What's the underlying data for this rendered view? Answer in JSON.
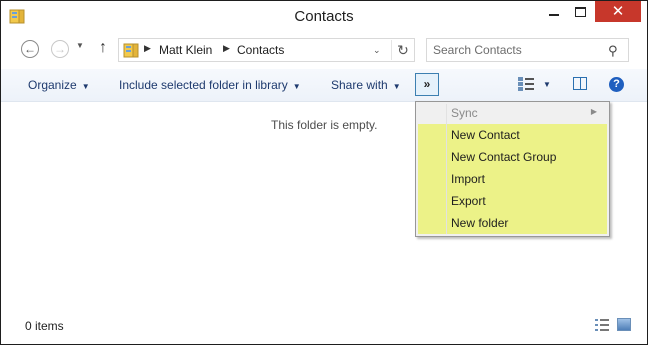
{
  "window": {
    "title": "Contacts",
    "close_glyph": "✕"
  },
  "nav": {
    "back_glyph": "←",
    "forward_glyph": "→",
    "recent_glyph": "▼",
    "up_glyph": "↑",
    "breadcrumb": [
      "Matt Klein",
      "Contacts"
    ],
    "separator_glyph": "▶",
    "dropdown_glyph": "⌄",
    "refresh_glyph": "↻",
    "search_placeholder": "Search Contacts",
    "search_glyph": "⚲"
  },
  "commandbar": {
    "organize": "Organize",
    "include_library": "Include selected folder in library",
    "share_with": "Share with",
    "more_glyph": "»",
    "arrow_glyph": "▼",
    "help_glyph": "?"
  },
  "content": {
    "empty_message": "This folder is empty."
  },
  "menu": {
    "items": [
      {
        "label": "Sync"
      },
      {
        "label": "New Contact"
      },
      {
        "label": "New Contact Group"
      },
      {
        "label": "Import"
      },
      {
        "label": "Export"
      },
      {
        "label": "New folder"
      }
    ],
    "submenu_glyph": "▶"
  },
  "status": {
    "item_count": "0 items"
  },
  "colors": {
    "close_red": "#c7372b",
    "menu_highlight": "#ecf288",
    "accent_blue": "#1f5fbf",
    "command_text": "#1e3a6e"
  }
}
